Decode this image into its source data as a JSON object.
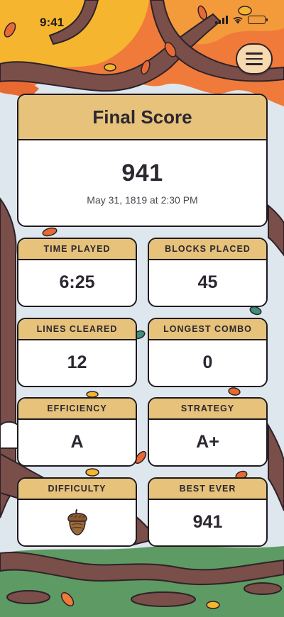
{
  "status_bar": {
    "time": "9:41"
  },
  "menu": {
    "icon": "hamburger-icon"
  },
  "final_score": {
    "title": "Final Score",
    "score": "941",
    "date": "May 31, 1819 at 2:30 PM"
  },
  "stats": {
    "time_played": {
      "label": "TIME PLAYED",
      "value": "6:25"
    },
    "blocks_placed": {
      "label": "BLOCKS PLACED",
      "value": "45"
    },
    "lines_cleared": {
      "label": "LINES CLEARED",
      "value": "12"
    },
    "longest_combo": {
      "label": "LONGEST COMBO",
      "value": "0"
    },
    "efficiency": {
      "label": "EFFICIENCY",
      "value": "A"
    },
    "strategy": {
      "label": "STRATEGY",
      "value": "A+"
    },
    "difficulty": {
      "label": "DIFFICULTY",
      "icon": "acorn-icon"
    },
    "best_ever": {
      "label": "BEST EVER",
      "value": "941"
    }
  },
  "colors": {
    "card_header": "#e6c27a",
    "card_border": "#1f1a1e",
    "text": "#2c2730",
    "menu_button": "#f7d9b0",
    "sky": "#dfe7ee",
    "grass": "#5e9a63",
    "leaf_orange": "#ef7a3a",
    "leaf_yellow": "#f6b52e",
    "trunk": "#7a4e49"
  }
}
